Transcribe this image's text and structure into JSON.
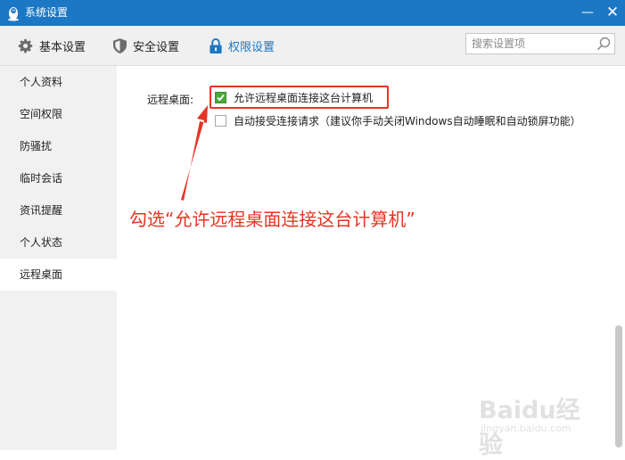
{
  "window": {
    "title": "系统设置",
    "minimize_glyph": "—",
    "close_glyph": "✕"
  },
  "toolbar": {
    "items": [
      {
        "label": "基本设置",
        "icon": "gear-icon"
      },
      {
        "label": "安全设置",
        "icon": "shield-icon"
      },
      {
        "label": "权限设置",
        "icon": "lock-icon",
        "active": true
      }
    ]
  },
  "search": {
    "placeholder": "搜索设置项",
    "value": ""
  },
  "sidebar": {
    "items": [
      {
        "label": "个人资料"
      },
      {
        "label": "空间权限"
      },
      {
        "label": "防骚扰"
      },
      {
        "label": "临时会话"
      },
      {
        "label": "资讯提醒"
      },
      {
        "label": "个人状态"
      },
      {
        "label": "远程桌面",
        "active": true
      }
    ]
  },
  "remote_desktop": {
    "label": "远程桌面:",
    "options": [
      {
        "label": "允许远程桌面连接这台计算机",
        "checked": true
      },
      {
        "label": "自动接受连接请求（建议你手动关闭Windows自动睡眠和自动锁屏功能）",
        "checked": false
      }
    ]
  },
  "annotation": {
    "text": "勾选“允许远程桌面连接这台计算机”",
    "color": "#e53423"
  },
  "watermark": {
    "brand": "Baidu经验",
    "url": "jingyan.baidu.com"
  },
  "colors": {
    "title_bar": "#1c78c4",
    "accent": "#1c78c4",
    "checkbox_checked": "#4aa93a",
    "annotation_red": "#e53423"
  }
}
